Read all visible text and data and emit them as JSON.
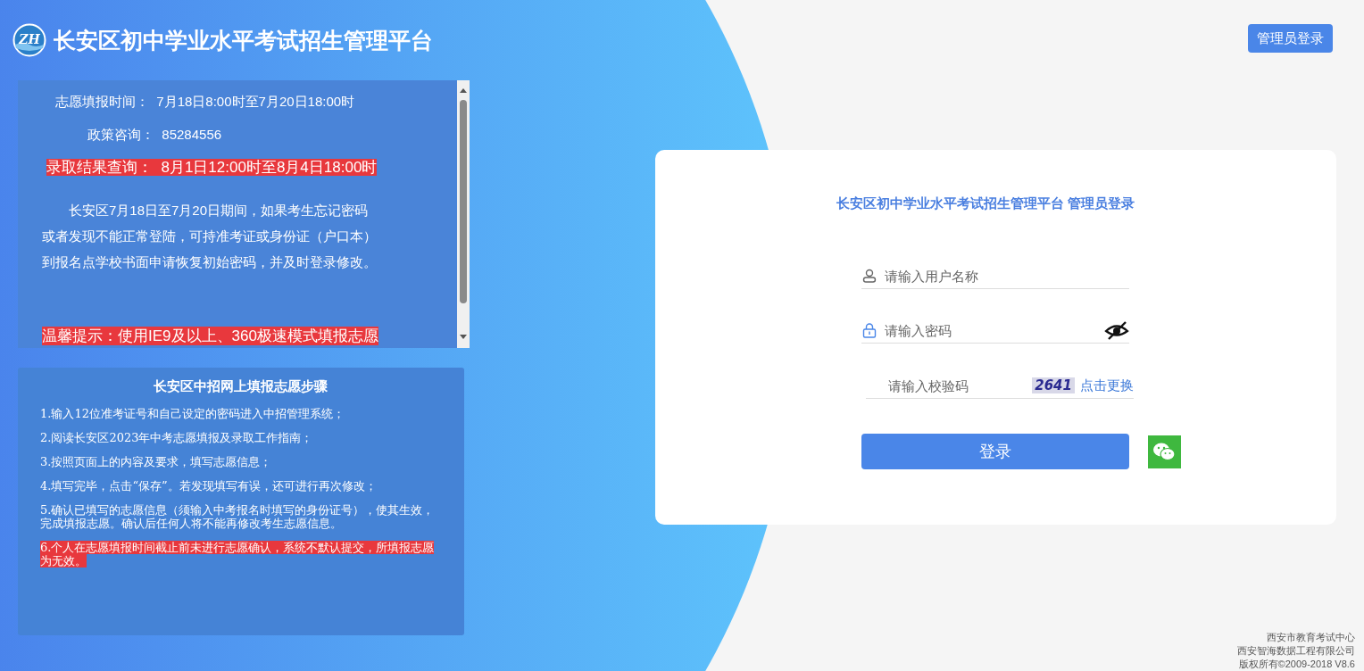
{
  "header": {
    "logo_text": "ZH",
    "title": "长安区初中学业水平考试招生管理平台",
    "admin_button": "管理员登录"
  },
  "notice": {
    "lines": [
      {
        "label": "志愿填报时间：",
        "value": "7月18日8:00时至7月20日18:00时",
        "highlight": false
      },
      {
        "label": "政策咨询：",
        "value": "85284556",
        "highlight": false
      },
      {
        "label": "录取结果查询：",
        "value": "8月1日12:00时至8月4日18:00时",
        "highlight": true
      }
    ],
    "paragraph": [
      "长安区7月18日至7月20日期间，如果考生忘记密码",
      "或者发现不能正常登陆，可持准考证或身份证（户口本）",
      "到报名点学校书面申请恢复初始密码，并及时登录修改。"
    ],
    "tip": "温馨提示：使用IE9及以上、360极速模式填报志愿"
  },
  "steps": {
    "title": "长安区中招网上填报志愿步骤",
    "items": [
      {
        "text": "1.输入12位准考证号和自己设定的密码进入中招管理系统；",
        "highlight": false
      },
      {
        "text": "2.阅读长安区2023年中考志愿填报及录取工作指南；",
        "highlight": false
      },
      {
        "text": "3.按照页面上的内容及要求，填写志愿信息；",
        "highlight": false
      },
      {
        "text": "4.填写完毕，点击“保存”。若发现填写有误，还可进行再次修改；",
        "highlight": false
      },
      {
        "text": "5.确认已填写的志愿信息（须输入中考报名时填写的身份证号），使其生效，完成填报志愿。确认后任何人将不能再修改考生志愿信息。",
        "highlight": false
      },
      {
        "text": "6.个人在志愿填报时间截止前未进行志愿确认，系统不默认提交，所填报志愿为无效。",
        "highlight": true
      }
    ]
  },
  "login": {
    "title": "长安区初中学业水平考试招生管理平台 管理员登录",
    "username": {
      "placeholder": "请输入用户名称"
    },
    "password": {
      "placeholder": "请输入密码"
    },
    "captcha": {
      "placeholder": "请输入校验码",
      "image_text": "2641",
      "refresh_link": "点击更换"
    },
    "submit_button": "登录"
  },
  "footer": [
    "西安市教育考试中心",
    "西安智海数据工程有限公司",
    "版权所有©2009-2018 V8.6"
  ]
}
